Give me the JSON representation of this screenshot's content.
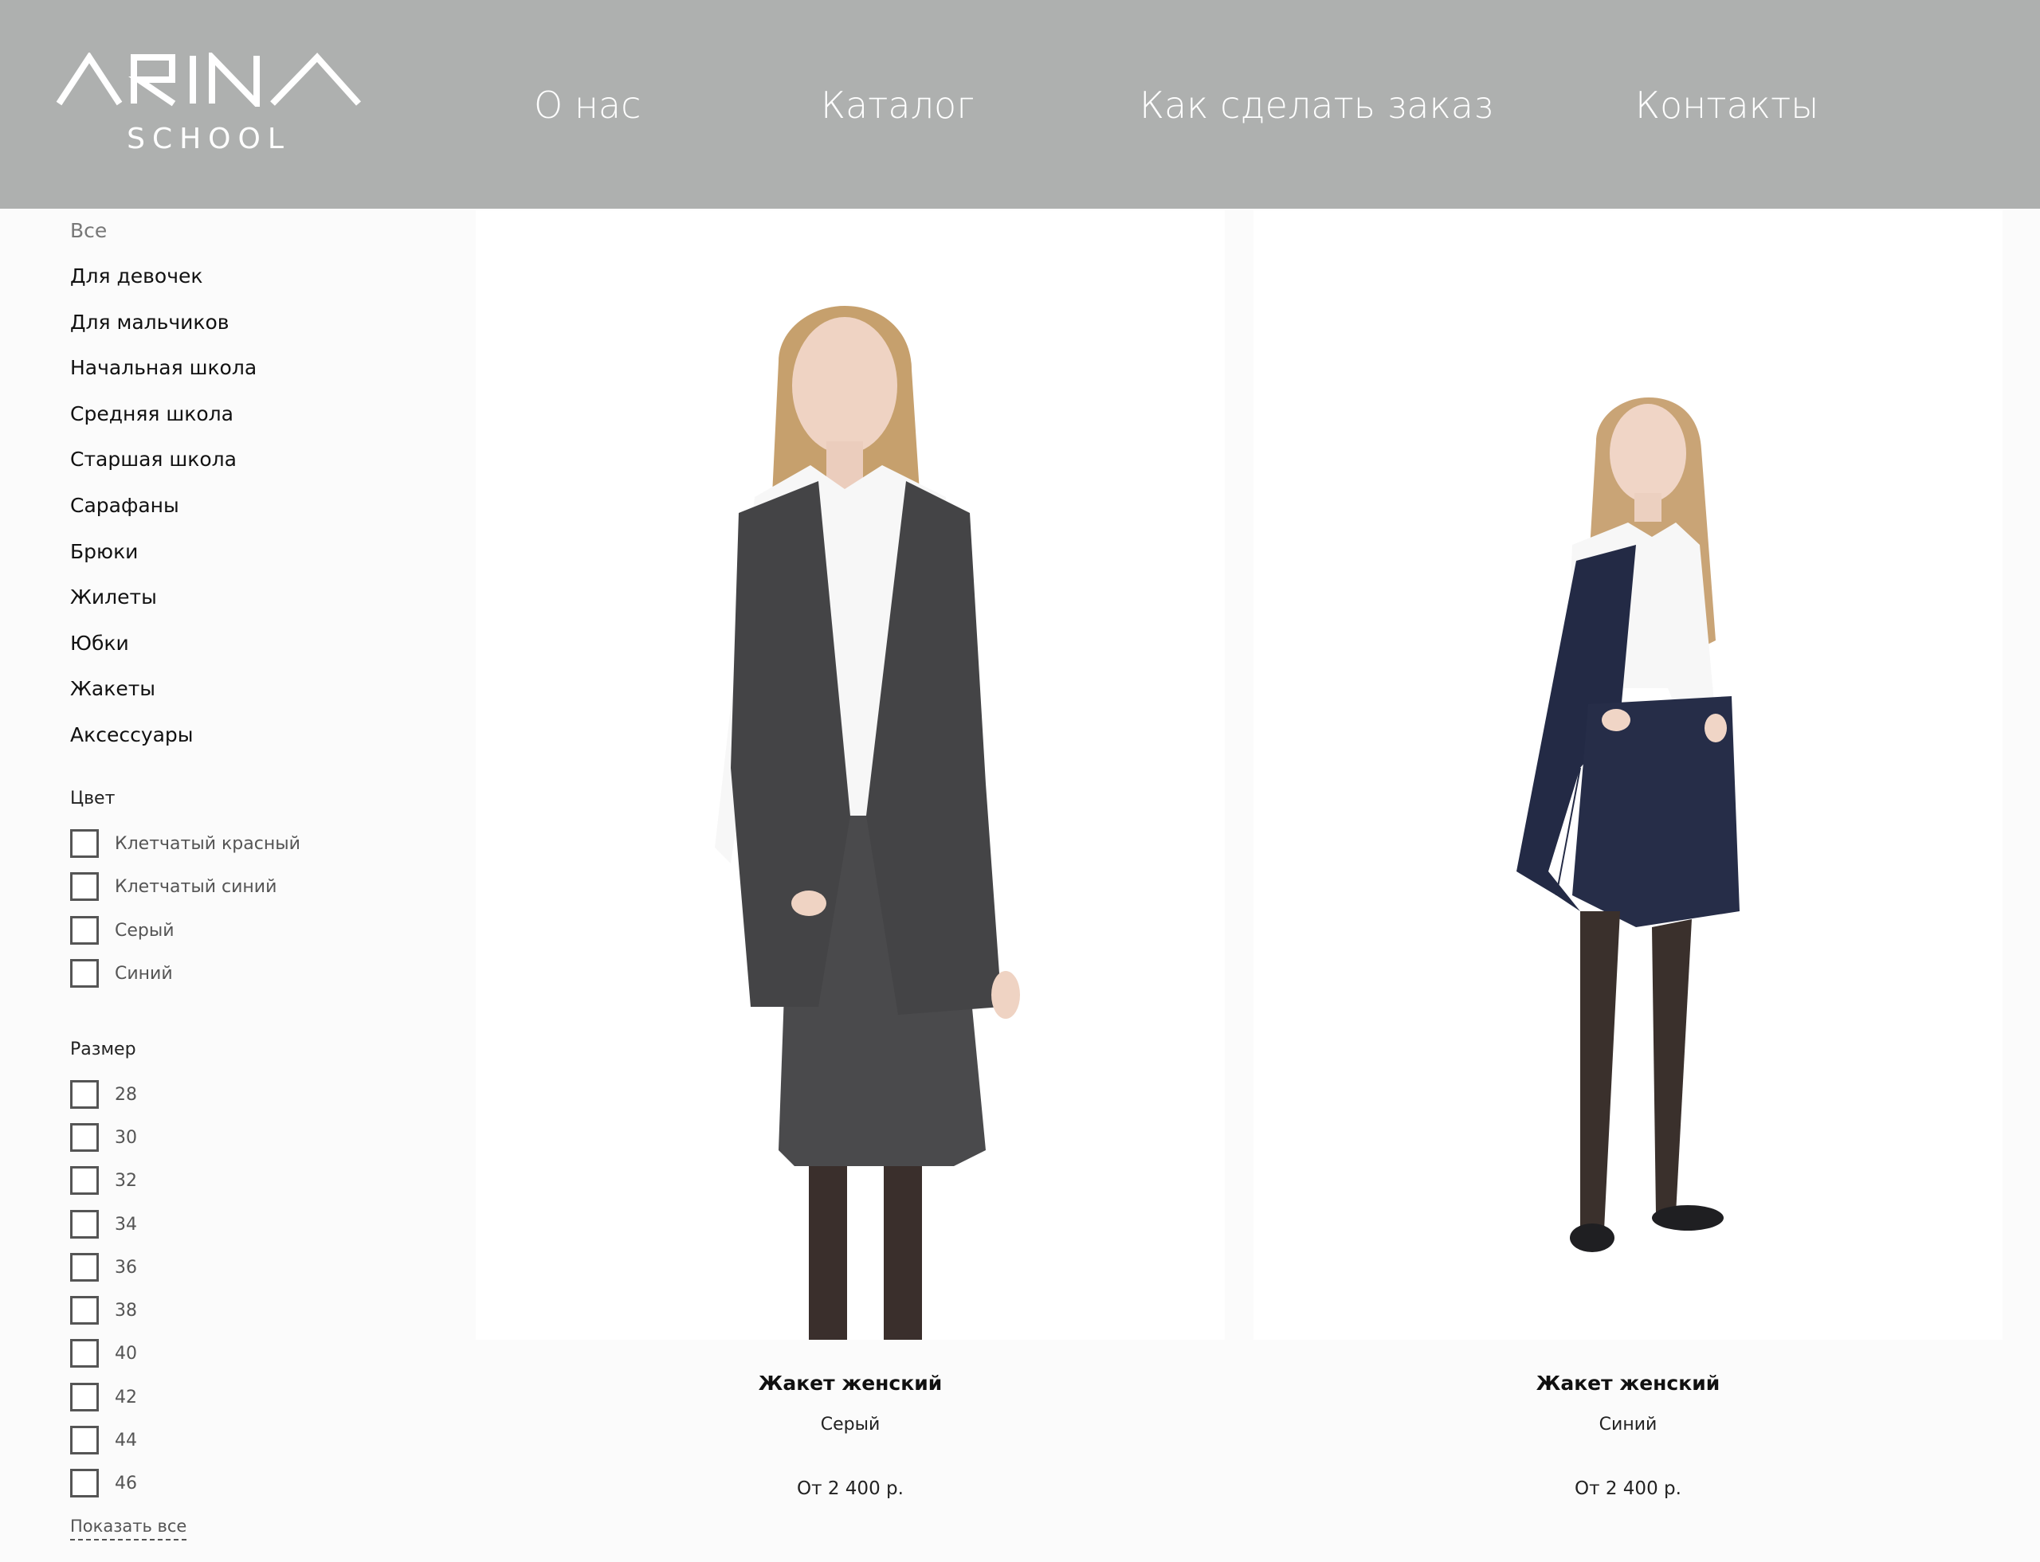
{
  "header": {
    "logo_main": "ARINA",
    "logo_sub": "SCHOOL",
    "nav": [
      "О нас",
      "Каталог",
      "Как сделать заказ",
      "Контакты"
    ]
  },
  "sidebar": {
    "categories": [
      "Все",
      "Для девочек",
      "Для мальчиков",
      "Начальная школа",
      "Средняя школа",
      "Старшая школа",
      "Сарафаны",
      "Брюки",
      "Жилеты",
      "Юбки",
      "Жакеты",
      "Аксессуары"
    ],
    "color_filter": {
      "title": "Цвет",
      "options": [
        "Клетчатый красный",
        "Клетчатый синий",
        "Серый",
        "Синий"
      ]
    },
    "size_filter": {
      "title": "Размер",
      "options": [
        "28",
        "30",
        "32",
        "34",
        "36",
        "38",
        "40",
        "42",
        "44",
        "46"
      ]
    },
    "show_all": "Показать все"
  },
  "products": [
    {
      "name": "Жакет женский",
      "color": "Серый",
      "price": "От 2 400 р.",
      "vest_color": "#444446",
      "skirt_color": "#4a4a4c"
    },
    {
      "name": "Жакет женский",
      "color": "Синий",
      "price": "От 2 400 р.",
      "vest_color": "#232a45",
      "skirt_color": "#262d48"
    }
  ]
}
